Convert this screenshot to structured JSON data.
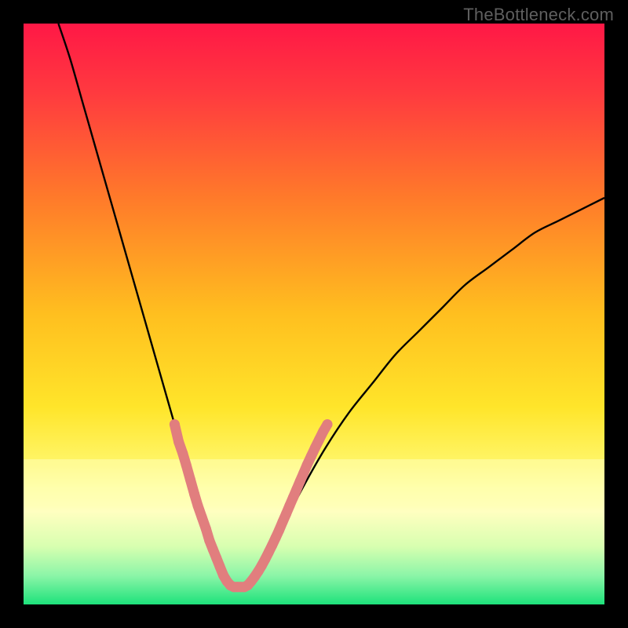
{
  "watermark": "TheBottleneck.com",
  "colors": {
    "bg_top": "#ff1846",
    "bg_mid": "#ffd600",
    "bg_band": "#ffff80",
    "bg_green": "#1de27b",
    "curve": "#000000",
    "markers": "#e17e7e",
    "frame": "#000000"
  },
  "chart_data": {
    "type": "line",
    "title": "",
    "xlabel": "",
    "ylabel": "",
    "xlim": [
      0,
      100
    ],
    "ylim": [
      0,
      100
    ],
    "series": [
      {
        "name": "bottleneck-curve",
        "x": [
          6,
          8,
          10,
          12,
          14,
          16,
          18,
          20,
          22,
          24,
          26,
          28,
          30,
          32,
          33,
          34,
          35,
          36,
          37,
          38,
          39,
          40,
          42,
          44,
          46,
          48,
          52,
          56,
          60,
          64,
          68,
          72,
          76,
          80,
          84,
          88,
          92,
          96,
          100
        ],
        "y": [
          100,
          94,
          87,
          80,
          73,
          66,
          59,
          52,
          45,
          38,
          31,
          24,
          17,
          11,
          8,
          6,
          4,
          3,
          3,
          3,
          4,
          5,
          8,
          12,
          16,
          20,
          27,
          33,
          38,
          43,
          47,
          51,
          55,
          58,
          61,
          64,
          66,
          68,
          70
        ]
      }
    ],
    "markers": {
      "name": "highlighted-range",
      "points": [
        {
          "x": 26.0,
          "y": 31
        },
        {
          "x": 26.7,
          "y": 28
        },
        {
          "x": 27.4,
          "y": 26
        },
        {
          "x": 28.0,
          "y": 24
        },
        {
          "x": 28.7,
          "y": 21.5
        },
        {
          "x": 29.4,
          "y": 19
        },
        {
          "x": 30.0,
          "y": 17
        },
        {
          "x": 30.7,
          "y": 15
        },
        {
          "x": 31.4,
          "y": 13
        },
        {
          "x": 32.0,
          "y": 11
        },
        {
          "x": 32.6,
          "y": 9.5
        },
        {
          "x": 33.2,
          "y": 8
        },
        {
          "x": 33.8,
          "y": 6.5
        },
        {
          "x": 34.4,
          "y": 5
        },
        {
          "x": 35.0,
          "y": 4
        },
        {
          "x": 35.6,
          "y": 3.3
        },
        {
          "x": 36.2,
          "y": 3
        },
        {
          "x": 36.8,
          "y": 3
        },
        {
          "x": 37.4,
          "y": 3
        },
        {
          "x": 38.0,
          "y": 3
        },
        {
          "x": 38.6,
          "y": 3.3
        },
        {
          "x": 39.2,
          "y": 4
        },
        {
          "x": 39.8,
          "y": 4.8
        },
        {
          "x": 40.4,
          "y": 5.7
        },
        {
          "x": 41.0,
          "y": 6.7
        },
        {
          "x": 41.6,
          "y": 7.8
        },
        {
          "x": 42.2,
          "y": 9
        },
        {
          "x": 42.8,
          "y": 10.2
        },
        {
          "x": 43.4,
          "y": 11.5
        },
        {
          "x": 44.0,
          "y": 12.8
        },
        {
          "x": 44.6,
          "y": 14.2
        },
        {
          "x": 45.2,
          "y": 15.6
        },
        {
          "x": 45.8,
          "y": 17
        },
        {
          "x": 46.4,
          "y": 18.4
        },
        {
          "x": 47.0,
          "y": 19.8
        },
        {
          "x": 47.6,
          "y": 21.2
        },
        {
          "x": 48.2,
          "y": 22.6
        },
        {
          "x": 48.8,
          "y": 24
        },
        {
          "x": 49.5,
          "y": 25.5
        },
        {
          "x": 50.2,
          "y": 27
        },
        {
          "x": 50.9,
          "y": 28.4
        },
        {
          "x": 51.6,
          "y": 29.8
        },
        {
          "x": 52.3,
          "y": 31
        }
      ]
    }
  }
}
